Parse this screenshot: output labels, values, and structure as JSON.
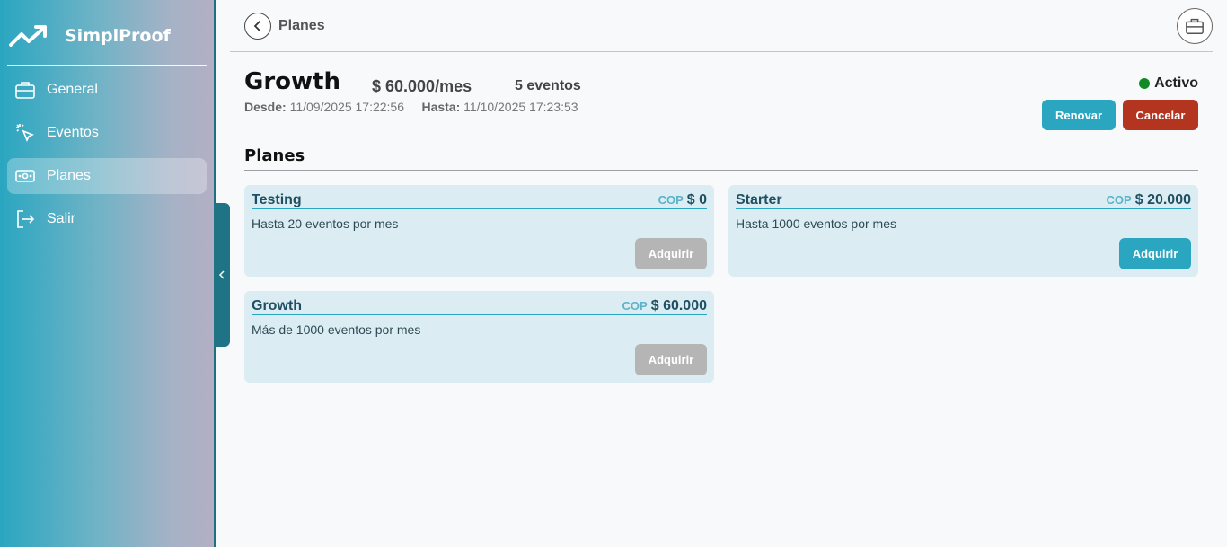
{
  "sidebar": {
    "brand": "SimplProof",
    "items": [
      {
        "label": "General",
        "icon": "briefcase-icon"
      },
      {
        "label": "Eventos",
        "icon": "click-cursor-icon"
      },
      {
        "label": "Planes",
        "icon": "money-icon",
        "active": true
      },
      {
        "label": "Salir",
        "icon": "logout-icon"
      }
    ]
  },
  "header": {
    "title": "Planes"
  },
  "current_plan": {
    "name": "Growth",
    "price": "$ 60.000/mes",
    "events": "5 eventos",
    "from_label": "Desde:",
    "from_value": "11/09/2025 17:22:56",
    "to_label": "Hasta:",
    "to_value": "11/10/2025 17:23:53",
    "status": "Activo",
    "status_color": "#118a24",
    "renew_label": "Renovar",
    "cancel_label": "Cancelar"
  },
  "plans_section": {
    "title": "Planes",
    "cards": [
      {
        "name": "Testing",
        "currency": "COP",
        "price": "$ 0",
        "description": "Hasta 20 eventos por mes",
        "button": "Adquirir",
        "enabled": false
      },
      {
        "name": "Starter",
        "currency": "COP",
        "price": "$ 20.000",
        "description": "Hasta 1000 eventos por mes",
        "button": "Adquirir",
        "enabled": true
      },
      {
        "name": "Growth",
        "currency": "COP",
        "price": "$ 60.000",
        "description": "Más de 1000 eventos por mes",
        "button": "Adquirir",
        "enabled": false
      }
    ]
  },
  "colors": {
    "accent": "#2aa6c0",
    "danger": "#b3341f",
    "disabled": "#b5b5b5"
  }
}
